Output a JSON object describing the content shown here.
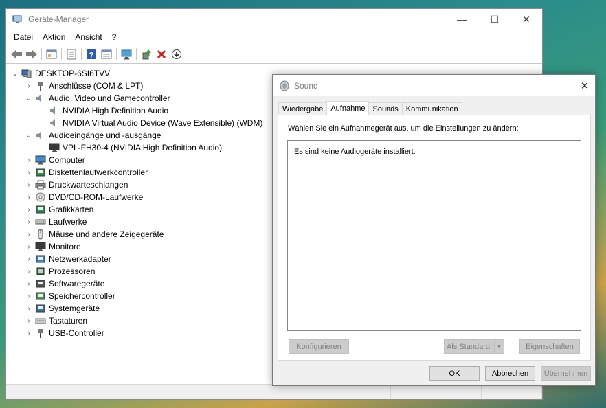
{
  "device_manager": {
    "title": "Geräte-Manager",
    "window_controls": {
      "minimize": "—",
      "maximize": "☐",
      "close": "✕"
    },
    "menu": [
      "Datei",
      "Aktion",
      "Ansicht",
      "?"
    ],
    "toolbar_icons": [
      "back-arrow-icon",
      "forward-arrow-icon",
      "properties-grid-icon",
      "list-view-icon",
      "help-icon",
      "details-icon",
      "monitor-scan-icon",
      "update-driver-icon",
      "uninstall-x-icon",
      "download-icon"
    ],
    "root": "DESKTOP-6SI6TVV",
    "tree": [
      {
        "label": "Anschlüsse (COM & LPT)",
        "level": 1,
        "expander": "›",
        "icon": "port-icon"
      },
      {
        "label": "Audio, Video und Gamecontroller",
        "level": 1,
        "expander": "⌄",
        "icon": "speaker-icon"
      },
      {
        "label": "NVIDIA High Definition Audio",
        "level": 2,
        "expander": "",
        "icon": "speaker-icon"
      },
      {
        "label": "NVIDIA Virtual Audio Device (Wave Extensible) (WDM)",
        "level": 2,
        "expander": "",
        "icon": "speaker-icon"
      },
      {
        "label": "Audioeingänge und -ausgänge",
        "level": 1,
        "expander": "⌄",
        "icon": "speaker-icon"
      },
      {
        "label": "VPL-FH30-4 (NVIDIA High Definition Audio)",
        "level": 2,
        "expander": "",
        "icon": "monitor-icon"
      },
      {
        "label": "Computer",
        "level": 1,
        "expander": "›",
        "icon": "computer-icon"
      },
      {
        "label": "Diskettenlaufwerkcontroller",
        "level": 1,
        "expander": "›",
        "icon": "floppy-controller-icon"
      },
      {
        "label": "Druckwarteschlangen",
        "level": 1,
        "expander": "›",
        "icon": "printer-icon"
      },
      {
        "label": "DVD/CD-ROM-Laufwerke",
        "level": 1,
        "expander": "›",
        "icon": "dvd-drive-icon"
      },
      {
        "label": "Grafikkarten",
        "level": 1,
        "expander": "›",
        "icon": "display-adapter-icon"
      },
      {
        "label": "Laufwerke",
        "level": 1,
        "expander": "›",
        "icon": "disk-drive-icon"
      },
      {
        "label": "Mäuse und andere Zeigegeräte",
        "level": 1,
        "expander": "›",
        "icon": "mouse-icon"
      },
      {
        "label": "Monitore",
        "level": 1,
        "expander": "›",
        "icon": "monitor-icon"
      },
      {
        "label": "Netzwerkadapter",
        "level": 1,
        "expander": "›",
        "icon": "network-adapter-icon"
      },
      {
        "label": "Prozessoren",
        "level": 1,
        "expander": "›",
        "icon": "processor-icon"
      },
      {
        "label": "Softwaregeräte",
        "level": 1,
        "expander": "›",
        "icon": "software-device-icon"
      },
      {
        "label": "Speichercontroller",
        "level": 1,
        "expander": "›",
        "icon": "storage-controller-icon"
      },
      {
        "label": "Systemgeräte",
        "level": 1,
        "expander": "›",
        "icon": "system-device-icon"
      },
      {
        "label": "Tastaturen",
        "level": 1,
        "expander": "›",
        "icon": "keyboard-icon"
      },
      {
        "label": "USB-Controller",
        "level": 1,
        "expander": "›",
        "icon": "usb-icon"
      }
    ]
  },
  "sound_dialog": {
    "title": "Sound",
    "close": "✕",
    "tabs": [
      "Wiedergabe",
      "Aufnahme",
      "Sounds",
      "Kommunikation"
    ],
    "active_tab": "Aufnahme",
    "prompt": "Wählen Sie ein Aufnahmegerät aus, um die Einstellungen zu ändern:",
    "empty_message": "Es sind keine Audiogeräte installiert.",
    "buttons": {
      "configure": "Konfigurieren",
      "set_default": "Als Standard",
      "properties": "Eigenschaften",
      "ok": "OK",
      "cancel": "Abbrechen",
      "apply": "Übernehmen"
    }
  }
}
